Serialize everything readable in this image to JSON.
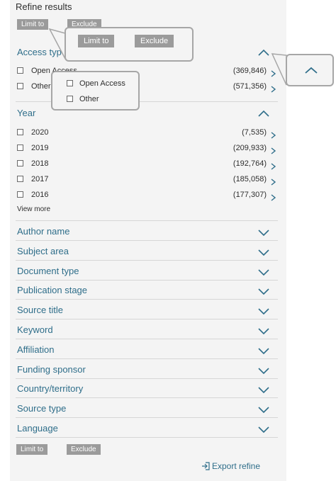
{
  "header": {
    "title": "Refine results"
  },
  "top_buttons": {
    "limit": "Limit to",
    "exclude": "Exclude"
  },
  "access_type": {
    "label": "Access type",
    "items": [
      {
        "label": "Open Access",
        "count": "(369,846)"
      },
      {
        "label": "Other",
        "count": "(571,356)"
      }
    ]
  },
  "popup_buttons": {
    "limit": "Limit to",
    "exclude": "Exclude"
  },
  "popup_access": {
    "open": "Open Access",
    "other": "Other"
  },
  "year": {
    "label": "Year",
    "items": [
      {
        "label": "2020",
        "count": "(7,535)"
      },
      {
        "label": "2019",
        "count": "(209,933)"
      },
      {
        "label": "2018",
        "count": "(192,764)"
      },
      {
        "label": "2017",
        "count": "(185,058)"
      },
      {
        "label": "2016",
        "count": "(177,307)"
      }
    ],
    "view_more": "View more"
  },
  "facets": [
    "Author name",
    "Subject area",
    "Document type",
    "Publication stage",
    "Source title",
    "Keyword",
    "Affiliation",
    "Funding sponsor",
    "Country/territory",
    "Source type",
    "Language"
  ],
  "bottom_buttons": {
    "limit": "Limit to",
    "exclude": "Exclude"
  },
  "export": {
    "label": "Export refine"
  },
  "colors": {
    "accent": "#2f6e8a",
    "button": "#9b9b9b",
    "panel": "#f4f4f4"
  },
  "icons": {
    "collapse": "chevron-up-icon",
    "expand": "chevron-down-icon",
    "row": "chevron-right-icon",
    "export": "export-icon"
  }
}
